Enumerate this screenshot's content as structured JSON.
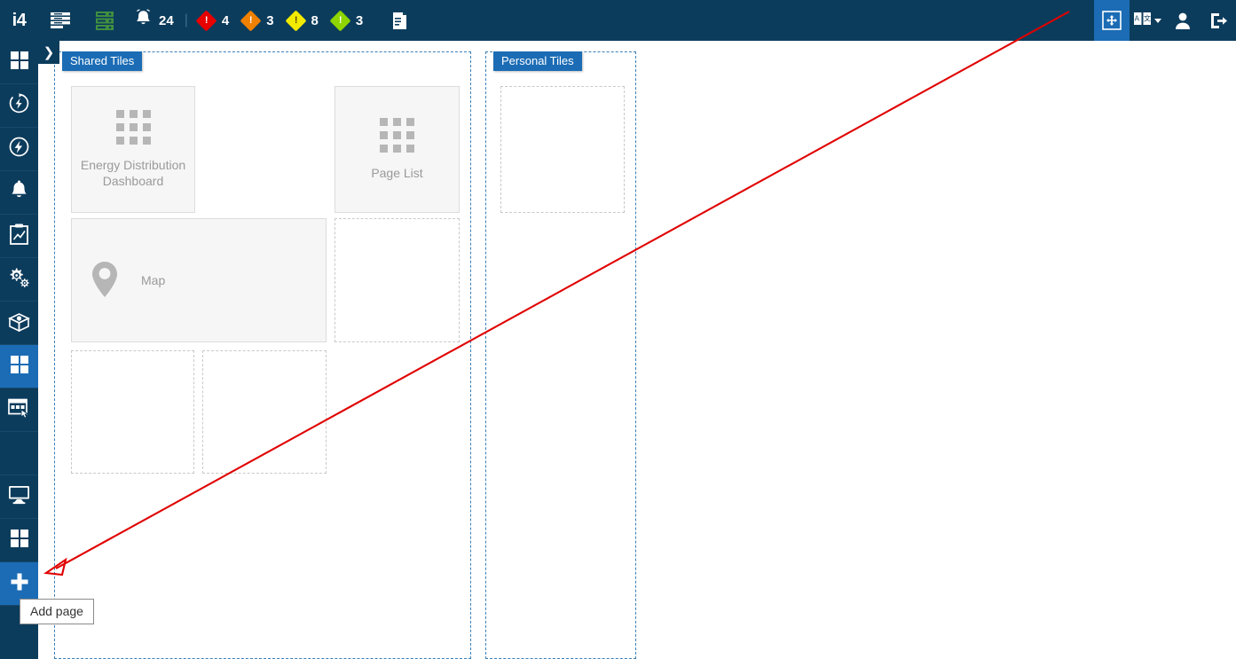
{
  "app": {
    "brand": "i4",
    "accent": "#1b6cb5",
    "header_bg": "#0c3c5c"
  },
  "topbar": {
    "brand_label": "i4",
    "menu_icon": "list-menu-icon",
    "server_icon": "server-icon",
    "notifications": {
      "icon": "bell-icon",
      "count": "24"
    },
    "separator": "|",
    "alarms": [
      {
        "name": "alarm-critical",
        "count": "4",
        "color": "#e60000",
        "excl_dark": false
      },
      {
        "name": "alarm-high",
        "count": "3",
        "color": "#f08000",
        "excl_dark": false
      },
      {
        "name": "alarm-medium",
        "count": "8",
        "color": "#f2ea00",
        "excl_dark": true
      },
      {
        "name": "alarm-low",
        "count": "3",
        "color": "#8ed400",
        "excl_dark": false
      }
    ],
    "manual_icon": "book-manual-icon",
    "right": {
      "edit_layout": {
        "label": "edit-layout",
        "icon": "move-arrows-icon",
        "active": true
      },
      "language": {
        "label": "language",
        "icon": "language-icon"
      },
      "user": {
        "label": "user",
        "icon": "user-icon"
      },
      "logout": {
        "label": "logout",
        "icon": "logout-icon"
      }
    }
  },
  "sidebar": {
    "expander_icon": "chevron-right-icon",
    "items": [
      {
        "name": "sidebar-item-dashboard",
        "icon": "grid-icon",
        "active": false
      },
      {
        "name": "sidebar-item-energy-live",
        "icon": "energy-refresh-icon",
        "active": false
      },
      {
        "name": "sidebar-item-energy",
        "icon": "energy-icon",
        "active": false
      },
      {
        "name": "sidebar-item-alarms",
        "icon": "bell-icon",
        "active": false
      },
      {
        "name": "sidebar-item-reports",
        "icon": "clipboard-chart-icon",
        "active": false
      },
      {
        "name": "sidebar-item-settings",
        "icon": "gears-icon",
        "active": false
      },
      {
        "name": "sidebar-item-packages",
        "icon": "open-box-icon",
        "active": false
      },
      {
        "name": "sidebar-item-pages",
        "icon": "grid-icon",
        "active": true
      },
      {
        "name": "sidebar-item-forms",
        "icon": "form-cursor-icon",
        "active": false
      },
      {
        "name": "sidebar-item-spacer",
        "icon": "",
        "active": false
      },
      {
        "name": "sidebar-item-visualization",
        "icon": "monitor-icon",
        "active": false
      },
      {
        "name": "sidebar-item-tiles",
        "icon": "grid-icon",
        "active": false
      },
      {
        "name": "sidebar-item-add-page",
        "icon": "plus-icon",
        "active": false,
        "highlight": true
      }
    ]
  },
  "zones": [
    {
      "name": "shared-tiles-zone",
      "label": "Shared Tiles"
    },
    {
      "name": "personal-tiles-zone",
      "label": "Personal Tiles"
    }
  ],
  "tiles": {
    "shared": [
      {
        "name": "tile-energy-distribution-dashboard",
        "label": "Energy Distribution Dashboard",
        "icon": "grid-9-icon",
        "placeholder": false
      },
      {
        "name": "tile-page-list",
        "label": "Page List",
        "icon": "grid-9-icon",
        "placeholder": false
      },
      {
        "name": "tile-map",
        "label": "Map",
        "icon": "map-pin-icon",
        "placeholder": false
      },
      {
        "name": "tile-placeholder-1",
        "label": "",
        "icon": "",
        "placeholder": true
      },
      {
        "name": "tile-placeholder-2",
        "label": "",
        "icon": "",
        "placeholder": true
      },
      {
        "name": "tile-placeholder-3",
        "label": "",
        "icon": "",
        "placeholder": true
      }
    ],
    "personal": [
      {
        "name": "tile-placeholder-personal-1",
        "label": "",
        "icon": "",
        "placeholder": true
      }
    ]
  },
  "tooltip": {
    "text": "Add page"
  },
  "annotation": {
    "color": "#e00000",
    "description": "arrow pointing to add-page button"
  }
}
